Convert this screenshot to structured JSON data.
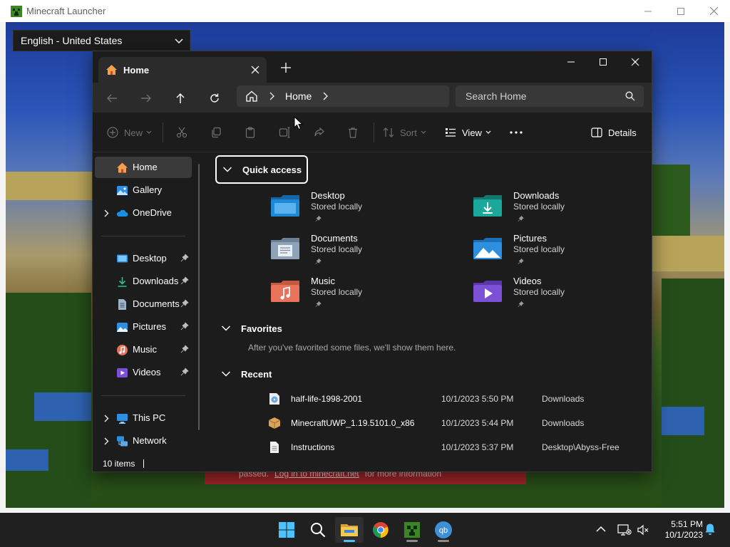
{
  "launcher": {
    "title": "Minecraft Launcher",
    "language": "English - United States",
    "banner_prefix": "passed.",
    "banner_link": "Log in to minecraft.net",
    "banner_suffix": "for more information"
  },
  "explorer": {
    "tab_label": "Home",
    "breadcrumb": [
      "Home"
    ],
    "search_placeholder": "Search Home",
    "toolbar": {
      "new_label": "New",
      "sort_label": "Sort",
      "view_label": "View",
      "details_label": "Details"
    },
    "sidebar": {
      "top": [
        {
          "label": "Home",
          "icon": "home-icon",
          "selected": true
        },
        {
          "label": "Gallery",
          "icon": "gallery-icon"
        },
        {
          "label": "OneDrive",
          "icon": "onedrive-icon",
          "expandable": true
        }
      ],
      "pinned": [
        {
          "label": "Desktop",
          "icon": "desktop-icon"
        },
        {
          "label": "Downloads",
          "icon": "downloads-icon"
        },
        {
          "label": "Documents",
          "icon": "documents-icon"
        },
        {
          "label": "Pictures",
          "icon": "pictures-icon"
        },
        {
          "label": "Music",
          "icon": "music-icon"
        },
        {
          "label": "Videos",
          "icon": "videos-icon"
        }
      ],
      "bottom": [
        {
          "label": "This PC",
          "icon": "this-pc-icon",
          "expandable": true
        },
        {
          "label": "Network",
          "icon": "network-icon",
          "expandable": true
        }
      ]
    },
    "quick_access": {
      "title": "Quick access",
      "folders": [
        {
          "name": "Desktop",
          "sub": "Stored locally",
          "icon": "desktop-folder-icon",
          "color": "#1e88d4"
        },
        {
          "name": "Downloads",
          "sub": "Stored locally",
          "icon": "downloads-folder-icon",
          "color": "#1aa89a"
        },
        {
          "name": "Documents",
          "sub": "Stored locally",
          "icon": "documents-folder-icon",
          "color": "#8fa3b8"
        },
        {
          "name": "Pictures",
          "sub": "Stored locally",
          "icon": "pictures-folder-icon",
          "color": "#2d8fe0"
        },
        {
          "name": "Music",
          "sub": "Stored locally",
          "icon": "music-folder-icon",
          "color": "#e8735a"
        },
        {
          "name": "Videos",
          "sub": "Stored locally",
          "icon": "videos-folder-icon",
          "color": "#7b4fd6"
        }
      ]
    },
    "favorites": {
      "title": "Favorites",
      "empty_text": "After you've favorited some files, we'll show them here."
    },
    "recent": {
      "title": "Recent",
      "items": [
        {
          "name": "half-life-1998-2001",
          "date": "10/1/2023 5:50 PM",
          "location": "Downloads",
          "icon": "disc-image-icon"
        },
        {
          "name": "MinecraftUWP_1.19.5101.0_x86",
          "date": "10/1/2023 5:44 PM",
          "location": "Downloads",
          "icon": "package-icon"
        },
        {
          "name": "Instructions",
          "date": "10/1/2023 5:37 PM",
          "location": "Desktop\\Abyss-Free",
          "icon": "text-file-icon"
        }
      ]
    },
    "status": {
      "items": "10 items"
    }
  },
  "taskbar": {
    "time": "5:51 PM",
    "date": "10/1/2023"
  },
  "colors": {
    "explorer_bg": "#1c1c1c",
    "navbar_bg": "#2b2b2b",
    "accent": "#4cc2ff",
    "banner_red": "#a3262a"
  }
}
